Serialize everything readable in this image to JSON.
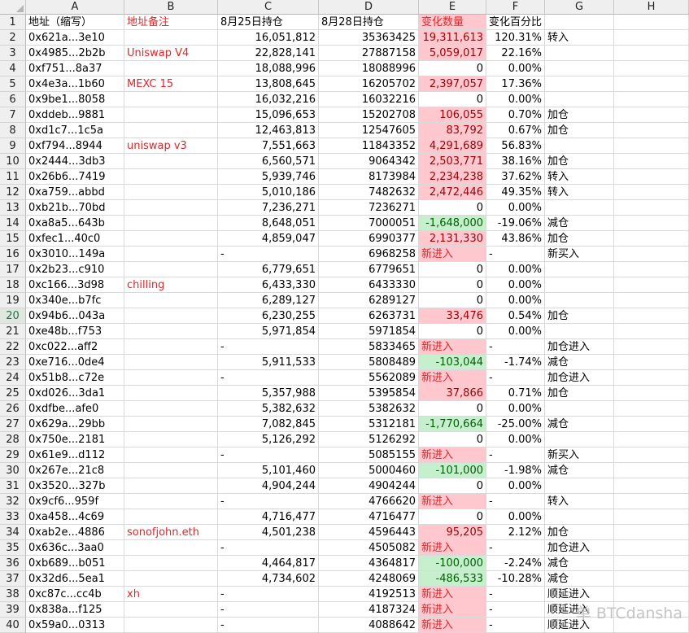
{
  "columns": [
    "A",
    "B",
    "C",
    "D",
    "E",
    "F",
    "G",
    "H"
  ],
  "selected_row": 20,
  "header": {
    "a": "地址（缩写）",
    "b": "地址备注",
    "c": "8月25日持仓",
    "d": "8月28日持仓",
    "e": "变化数量",
    "f": "变化百分比"
  },
  "rows": [
    {
      "n": "2",
      "a": "0x621a...3e10",
      "b": "",
      "c": "16,051,812",
      "d": "35363425",
      "e": "19,311,613",
      "f": "120.31%",
      "g": "转入",
      "k": "pos"
    },
    {
      "n": "3",
      "a": "0x4985...2b2b",
      "b": "Uniswap V4",
      "c": "22,828,141",
      "d": "27887158",
      "e": "5,059,017",
      "f": "22.16%",
      "g": "",
      "k": "pos"
    },
    {
      "n": "4",
      "a": "0xf751...8a37",
      "b": "",
      "c": "18,088,996",
      "d": "18088996",
      "e": "0",
      "f": "0.00%",
      "g": "",
      "k": ""
    },
    {
      "n": "5",
      "a": "0x4e3a...1b60",
      "b": "MEXC 15",
      "c": "13,808,645",
      "d": "16205702",
      "e": "2,397,057",
      "f": "17.36%",
      "g": "",
      "k": "pos"
    },
    {
      "n": "6",
      "a": "0x9be1...8058",
      "b": "",
      "c": "16,032,216",
      "d": "16032216",
      "e": "0",
      "f": "0.00%",
      "g": "",
      "k": ""
    },
    {
      "n": "7",
      "a": "0xddeb...9881",
      "b": "",
      "c": "15,096,653",
      "d": "15202708",
      "e": "106,055",
      "f": "0.70%",
      "g": "加仓",
      "k": "pos"
    },
    {
      "n": "8",
      "a": "0xd1c7...1c5a",
      "b": "",
      "c": "12,463,813",
      "d": "12547605",
      "e": "83,792",
      "f": "0.67%",
      "g": "加仓",
      "k": "pos"
    },
    {
      "n": "9",
      "a": "0xf794...8944",
      "b": "uniswap v3",
      "c": "7,551,663",
      "d": "11843352",
      "e": "4,291,689",
      "f": "56.83%",
      "g": "",
      "k": "pos"
    },
    {
      "n": "10",
      "a": "0x2444...3db3",
      "b": "",
      "c": "6,560,571",
      "d": "9064342",
      "e": "2,503,771",
      "f": "38.16%",
      "g": "加仓",
      "k": "pos"
    },
    {
      "n": "11",
      "a": "0x26b6...7419",
      "b": "",
      "c": "5,939,746",
      "d": "8173984",
      "e": "2,234,238",
      "f": "37.62%",
      "g": "转入",
      "k": "pos"
    },
    {
      "n": "12",
      "a": "0xa759...abbd",
      "b": "",
      "c": "5,010,186",
      "d": "7482632",
      "e": "2,472,446",
      "f": "49.35%",
      "g": "转入",
      "k": "pos"
    },
    {
      "n": "13",
      "a": "0xb21b...70bd",
      "b": "",
      "c": "7,236,271",
      "d": "7236271",
      "e": "0",
      "f": "0.00%",
      "g": "",
      "k": ""
    },
    {
      "n": "14",
      "a": "0xa8a5...643b",
      "b": "",
      "c": "8,648,051",
      "d": "7000051",
      "e": "-1,648,000",
      "f": "-19.06%",
      "g": "减仓",
      "k": "neg"
    },
    {
      "n": "15",
      "a": "0xfec1...40c0",
      "b": "",
      "c": "4,859,047",
      "d": "6990377",
      "e": "2,131,330",
      "f": "43.86%",
      "g": "加仓",
      "k": "pos"
    },
    {
      "n": "16",
      "a": "0x3010...149a",
      "b": "",
      "c": "-",
      "d": "6968258",
      "e": "新进入",
      "f": "-",
      "g": "新买入",
      "k": "new"
    },
    {
      "n": "17",
      "a": "0x2b23...c910",
      "b": "",
      "c": "6,779,651",
      "d": "6779651",
      "e": "0",
      "f": "0.00%",
      "g": "",
      "k": ""
    },
    {
      "n": "18",
      "a": "0xc166...3d98",
      "b": "chilling",
      "c": "6,433,330",
      "d": "6433330",
      "e": "0",
      "f": "0.00%",
      "g": "",
      "k": ""
    },
    {
      "n": "19",
      "a": "0x340e...b7fc",
      "b": "",
      "c": "6,289,127",
      "d": "6289127",
      "e": "0",
      "f": "0.00%",
      "g": "",
      "k": ""
    },
    {
      "n": "20",
      "a": "0x94b6...043a",
      "b": "",
      "c": "6,230,255",
      "d": "6263731",
      "e": "33,476",
      "f": "0.54%",
      "g": "加仓",
      "k": "pos"
    },
    {
      "n": "21",
      "a": "0xe48b...f753",
      "b": "",
      "c": "5,971,854",
      "d": "5971854",
      "e": "0",
      "f": "0.00%",
      "g": "",
      "k": ""
    },
    {
      "n": "22",
      "a": "0xc022...aff2",
      "b": "",
      "c": "-",
      "d": "5833465",
      "e": "新进入",
      "f": "-",
      "g": "加仓进入",
      "k": "new"
    },
    {
      "n": "23",
      "a": "0xe716...0de4",
      "b": "",
      "c": "5,911,533",
      "d": "5808489",
      "e": "-103,044",
      "f": "-1.74%",
      "g": "减仓",
      "k": "neg"
    },
    {
      "n": "24",
      "a": "0x51b8...c72e",
      "b": "",
      "c": "-",
      "d": "5562089",
      "e": "新进入",
      "f": "-",
      "g": "加仓进入",
      "k": "new"
    },
    {
      "n": "25",
      "a": "0xd026...3da1",
      "b": "",
      "c": "5,357,988",
      "d": "5395854",
      "e": "37,866",
      "f": "0.71%",
      "g": "加仓",
      "k": "pos"
    },
    {
      "n": "26",
      "a": "0xdfbe...afe0",
      "b": "",
      "c": "5,382,632",
      "d": "5382632",
      "e": "0",
      "f": "0.00%",
      "g": "",
      "k": ""
    },
    {
      "n": "27",
      "a": "0x629a...29bb",
      "b": "",
      "c": "7,082,845",
      "d": "5312181",
      "e": "-1,770,664",
      "f": "-25.00%",
      "g": "减仓",
      "k": "neg"
    },
    {
      "n": "28",
      "a": "0x750e...2181",
      "b": "",
      "c": "5,126,292",
      "d": "5126292",
      "e": "0",
      "f": "0.00%",
      "g": "",
      "k": ""
    },
    {
      "n": "29",
      "a": "0x61e9...d112",
      "b": "",
      "c": "-",
      "d": "5085155",
      "e": "新进入",
      "f": "-",
      "g": "新买入",
      "k": "new"
    },
    {
      "n": "30",
      "a": "0x267e...21c8",
      "b": "",
      "c": "5,101,460",
      "d": "5000460",
      "e": "-101,000",
      "f": "-1.98%",
      "g": "减仓",
      "k": "neg"
    },
    {
      "n": "31",
      "a": "0x3520...327b",
      "b": "",
      "c": "4,904,244",
      "d": "4904244",
      "e": "0",
      "f": "0.00%",
      "g": "",
      "k": ""
    },
    {
      "n": "32",
      "a": "0x9cf6...959f",
      "b": "",
      "c": "-",
      "d": "4766620",
      "e": "新进入",
      "f": "-",
      "g": "转入",
      "k": "new"
    },
    {
      "n": "33",
      "a": "0xa458...4c69",
      "b": "",
      "c": "4,716,477",
      "d": "4716477",
      "e": "0",
      "f": "0.00%",
      "g": "",
      "k": ""
    },
    {
      "n": "34",
      "a": "0xab2e...4886",
      "b": "sonofjohn.eth",
      "c": "4,501,238",
      "d": "4596443",
      "e": "95,205",
      "f": "2.12%",
      "g": "加仓",
      "k": "pos"
    },
    {
      "n": "35",
      "a": "0x636c...3aa0",
      "b": "",
      "c": "-",
      "d": "4505082",
      "e": "新进入",
      "f": "-",
      "g": "加仓进入",
      "k": "new"
    },
    {
      "n": "36",
      "a": "0xb689...b051",
      "b": "",
      "c": "4,464,817",
      "d": "4364817",
      "e": "-100,000",
      "f": "-2.24%",
      "g": "减仓",
      "k": "neg"
    },
    {
      "n": "37",
      "a": "0x32d6...5ea1",
      "b": "",
      "c": "4,734,602",
      "d": "4248069",
      "e": "-486,533",
      "f": "-10.28%",
      "g": "减仓",
      "k": "neg"
    },
    {
      "n": "38",
      "a": "0xc87c...cc4b",
      "b": "xh",
      "c": "-",
      "d": "4192513",
      "e": "新进入",
      "f": "-",
      "g": "顺延进入",
      "k": "new"
    },
    {
      "n": "39",
      "a": "0x838a...f125",
      "b": "",
      "c": "-",
      "d": "4187324",
      "e": "新进入",
      "f": "-",
      "g": "顺延进入",
      "k": "new"
    },
    {
      "n": "40",
      "a": "0x59a0...0313",
      "b": "",
      "c": "-",
      "d": "4088642",
      "e": "新进入",
      "f": "-",
      "g": "顺延进入",
      "k": "new"
    }
  ],
  "watermark": "单 BTCdansha"
}
